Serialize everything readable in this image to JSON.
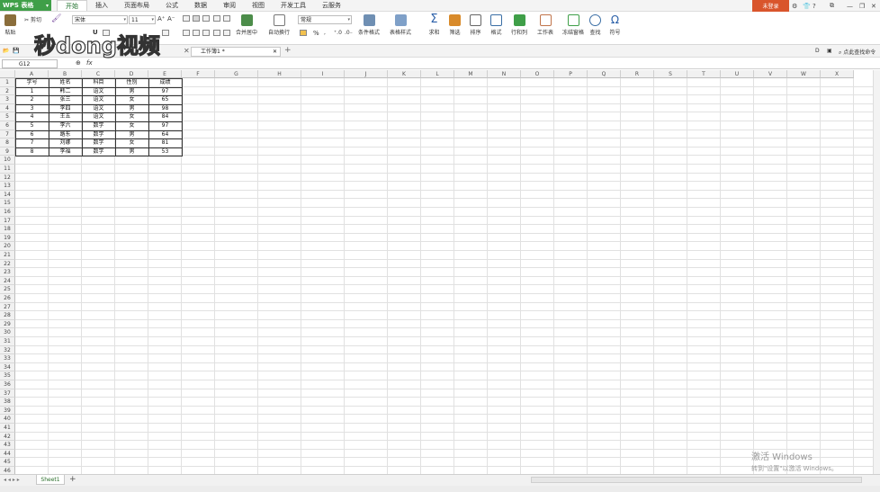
{
  "app": {
    "name": "WPS 表格"
  },
  "tabs": [
    "开始",
    "插入",
    "页面布局",
    "公式",
    "数据",
    "审阅",
    "视图",
    "开发工具",
    "云服务"
  ],
  "active_tab": "开始",
  "login_label": "未登录",
  "ribbon": {
    "paste": "粘贴",
    "cut": "剪切",
    "font_name": "宋体",
    "font_size": "11",
    "merge": "合并居中",
    "wrap": "自动换行",
    "number_format": "常规",
    "percent": "%",
    "cond_format": "条件格式",
    "table_style": "表格样式",
    "sum": "求和",
    "filter": "筛选",
    "sort": "排序",
    "format": "格式",
    "rowcol": "行和列",
    "sheet": "工作表",
    "freeze": "冻结窗格",
    "find": "查找",
    "symbol": "符号"
  },
  "doc_tab": "工作簿1 *",
  "search_cmd": "点此查找命令",
  "name_box": "G12",
  "fx": "fx",
  "columns": [
    "A",
    "B",
    "C",
    "D",
    "E",
    "F",
    "G",
    "H",
    "I",
    "J",
    "K",
    "L",
    "M",
    "N",
    "O",
    "P",
    "Q",
    "R",
    "S",
    "T",
    "U",
    "V",
    "W",
    "X"
  ],
  "rows": [
    1,
    2,
    3,
    4,
    5,
    6,
    7,
    8,
    9,
    10,
    11,
    12,
    13,
    14,
    15,
    16,
    17,
    18,
    19,
    20,
    21,
    22,
    23,
    24,
    25,
    26,
    27,
    28,
    29,
    30,
    31,
    32,
    33,
    34,
    35,
    36,
    37,
    38,
    39,
    40,
    41,
    42,
    43,
    44,
    45,
    46
  ],
  "table": {
    "headers": [
      "学号",
      "姓名",
      "科目",
      "性别",
      "成绩"
    ],
    "rows": [
      [
        "1",
        "韩二",
        "语文",
        "男",
        "97"
      ],
      [
        "2",
        "张三",
        "语文",
        "女",
        "65"
      ],
      [
        "3",
        "李四",
        "语文",
        "男",
        "98"
      ],
      [
        "4",
        "王五",
        "语文",
        "女",
        "84"
      ],
      [
        "5",
        "李六",
        "数学",
        "女",
        "97"
      ],
      [
        "6",
        "路东",
        "数学",
        "男",
        "64"
      ],
      [
        "7",
        "刘娜",
        "数学",
        "女",
        "81"
      ],
      [
        "8",
        "李福",
        "数学",
        "男",
        "53"
      ]
    ]
  },
  "sheet_tab": "Sheet1",
  "watermark": {
    "line1": "激活 Windows",
    "line2": "转到\"设置\"以激活 Windows。"
  },
  "logo_text": "秒dong视频",
  "colors": {
    "accent": "#3f9f48",
    "login": "#d9552c"
  }
}
